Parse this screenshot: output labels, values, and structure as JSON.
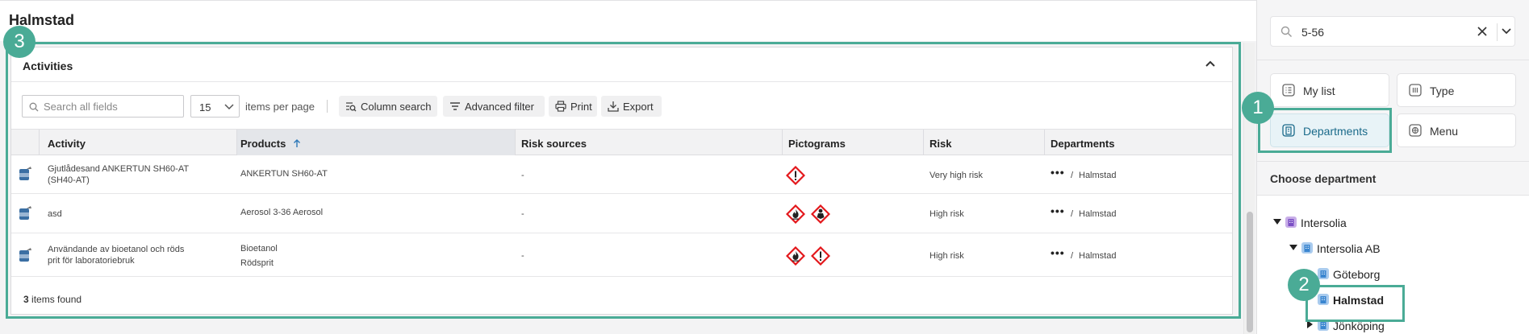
{
  "page": {
    "title": "Halmstad"
  },
  "card": {
    "title": "Activities",
    "search_placeholder": "Search all fields",
    "page_size": "15",
    "per_page_label": "items per page",
    "buttons": {
      "column_search": "Column search",
      "advanced_filter": "Advanced filter",
      "print": "Print",
      "export": "Export"
    },
    "columns": [
      "Activity",
      "Products",
      "Risk sources",
      "Pictograms",
      "Risk",
      "Departments"
    ],
    "sorted_column": "Products",
    "rows": [
      {
        "activity": [
          "Gjutlådesand ANKERTUN SH60-AT",
          "(SH40-AT)"
        ],
        "products": [
          "ANKERTUN SH60-AT"
        ],
        "risk_sources": "-",
        "pictograms": [
          "health-hazard-pictogram"
        ],
        "risk": "Very high risk",
        "department_more": "•••",
        "department_sep": "/",
        "department": "Halmstad"
      },
      {
        "activity": [
          "asd"
        ],
        "products": [
          "Aerosol 3-36 Aerosol"
        ],
        "risk_sources": "-",
        "pictograms": [
          "flammable-pictogram",
          "environment-pictogram"
        ],
        "risk": "High risk",
        "department_more": "•••",
        "department_sep": "/",
        "department": "Halmstad"
      },
      {
        "activity": [
          "Användande av bioetanol och röds",
          "prit för laboratoriebruk"
        ],
        "products": [
          "Bioetanol",
          "Rödsprit"
        ],
        "risk_sources": "-",
        "pictograms": [
          "flammable-pictogram",
          "health-hazard-pictogram"
        ],
        "risk": "High risk",
        "department_more": "•••",
        "department_sep": "/",
        "department": "Halmstad"
      }
    ],
    "items_found_count": "3",
    "items_found_label": "items found"
  },
  "sidebar": {
    "search_value": "5-56",
    "nav": {
      "my_list": "My list",
      "type": "Type",
      "departments": "Departments",
      "menu": "Menu"
    },
    "active_nav": "Departments",
    "choose_department": "Choose department",
    "tree": [
      {
        "label": "Intersolia",
        "level": 0,
        "expanded": true
      },
      {
        "label": "Intersolia AB",
        "level": 1,
        "expanded": true
      },
      {
        "label": "Göteborg",
        "level": 2
      },
      {
        "label": "Halmstad",
        "level": 2,
        "selected": true
      },
      {
        "label": "Jönköping",
        "level": 2,
        "expanded": false
      }
    ]
  },
  "annotations": {
    "badge_1": "1",
    "badge_2": "2",
    "badge_3": "3"
  },
  "colors": {
    "accent": "#4aab96",
    "pictogram_red": "#e3171b",
    "active_nav_bg": "#e8f3f7",
    "active_nav_text": "#1a6a8a"
  }
}
